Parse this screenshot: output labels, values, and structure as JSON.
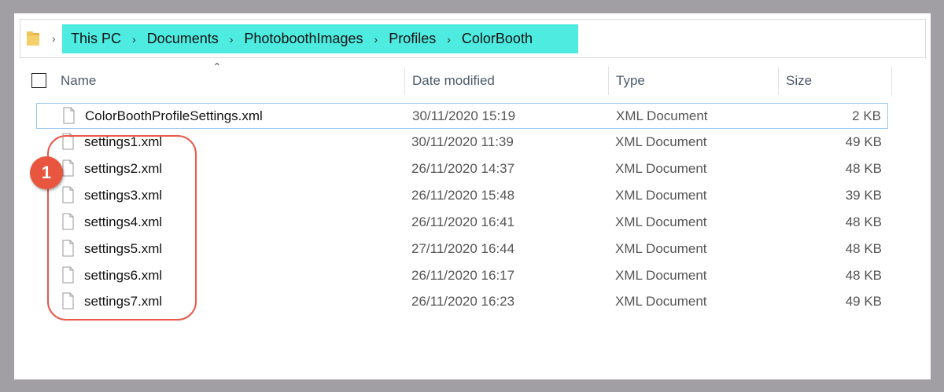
{
  "breadcrumb": [
    "This PC",
    "Documents",
    "PhotoboothImages",
    "Profiles",
    "ColorBooth"
  ],
  "columns": {
    "name": "Name",
    "date": "Date modified",
    "type": "Type",
    "size": "Size"
  },
  "files": [
    {
      "name": "ColorBoothProfileSettings.xml",
      "date": "30/11/2020 15:19",
      "type": "XML Document",
      "size": "2 KB"
    },
    {
      "name": "settings1.xml",
      "date": "30/11/2020 11:39",
      "type": "XML Document",
      "size": "49 KB"
    },
    {
      "name": "settings2.xml",
      "date": "26/11/2020 14:37",
      "type": "XML Document",
      "size": "48 KB"
    },
    {
      "name": "settings3.xml",
      "date": "26/11/2020 15:48",
      "type": "XML Document",
      "size": "39 KB"
    },
    {
      "name": "settings4.xml",
      "date": "26/11/2020 16:41",
      "type": "XML Document",
      "size": "48 KB"
    },
    {
      "name": "settings5.xml",
      "date": "27/11/2020 16:44",
      "type": "XML Document",
      "size": "48 KB"
    },
    {
      "name": "settings6.xml",
      "date": "26/11/2020 16:17",
      "type": "XML Document",
      "size": "48 KB"
    },
    {
      "name": "settings7.xml",
      "date": "26/11/2020 16:23",
      "type": "XML Document",
      "size": "49 KB"
    }
  ],
  "annotation": {
    "number": "1"
  },
  "colors": {
    "highlight": "#4eebe1",
    "callout": "#e8594a",
    "focus_border": "#99c9ef"
  },
  "icons": {
    "folder": "folder-icon",
    "file": "file-icon",
    "separator": "chevron-right-icon",
    "sort": "sort-ascending-icon"
  }
}
